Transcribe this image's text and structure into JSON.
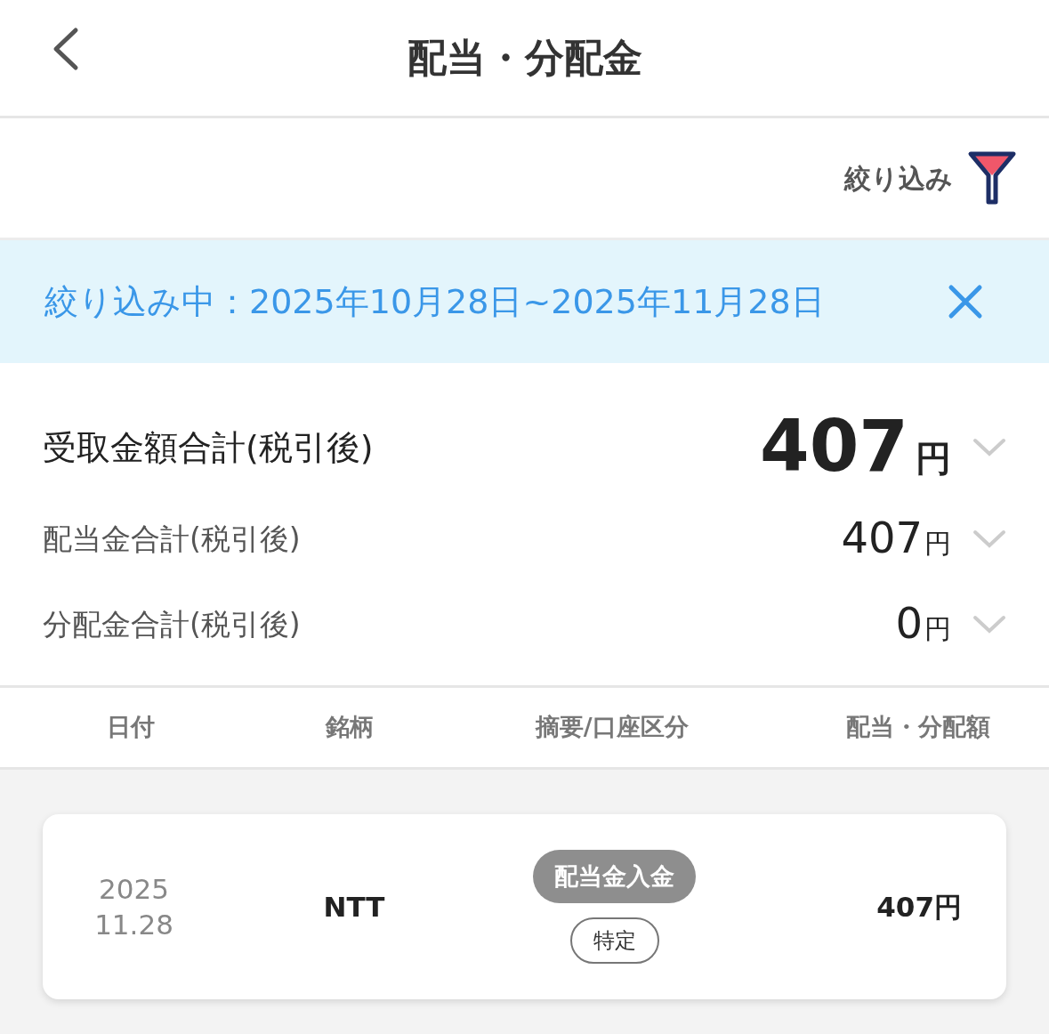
{
  "header": {
    "title": "配当・分配金"
  },
  "filter": {
    "label": "絞り込み"
  },
  "active_filter": {
    "label": "絞り込み中：2025年10月28日~2025年11月28日"
  },
  "summary": [
    {
      "kind": "total",
      "label": "受取金額合計(税引後)",
      "amount": "407",
      "unit": "円"
    },
    {
      "kind": "sub",
      "label": "配当金合計(税引後)",
      "amount": "407",
      "unit": "円"
    },
    {
      "kind": "sub",
      "label": "分配金合計(税引後)",
      "amount": "0",
      "unit": "円"
    }
  ],
  "table": {
    "columns": [
      "日付",
      "銘柄",
      "摘要/口座区分",
      "配当・分配額"
    ],
    "rows": [
      {
        "year": "2025",
        "day": "11.28",
        "security": "NTT",
        "type": "配当金入金",
        "account": "特定",
        "amount": "407円"
      }
    ]
  }
}
